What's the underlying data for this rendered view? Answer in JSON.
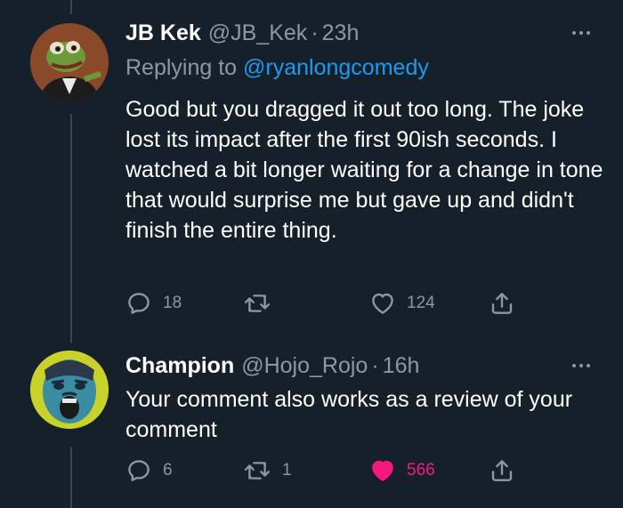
{
  "tweets": [
    {
      "name": "JB Kek",
      "handle": "@JB_Kek",
      "separator": "·",
      "time": "23h",
      "replying_prefix": "Replying to ",
      "replying_to": "@ryanlongcomedy",
      "text": "Good but you dragged it out too long. The joke lost its impact after the first 90ish seconds. I watched a bit longer waiting for a change in tone that would surprise me but gave up and didn't finish the entire thing.",
      "replies": "18",
      "retweets": "",
      "likes": "124",
      "liked": false
    },
    {
      "name": "Champion",
      "handle": "@Hojo_Rojo",
      "separator": "·",
      "time": "16h",
      "text": "Your comment also works as a review of your comment",
      "replies": "6",
      "retweets": "1",
      "likes": "566",
      "liked": true
    }
  ],
  "icons": {
    "reply": "reply-icon",
    "retweet": "retweet-icon",
    "like": "heart-icon",
    "share": "share-icon",
    "more": "more-icon"
  },
  "colors": {
    "background": "#15202b",
    "secondary_text": "#8b98a5",
    "link": "#1d9bf0",
    "like": "#f91880"
  }
}
